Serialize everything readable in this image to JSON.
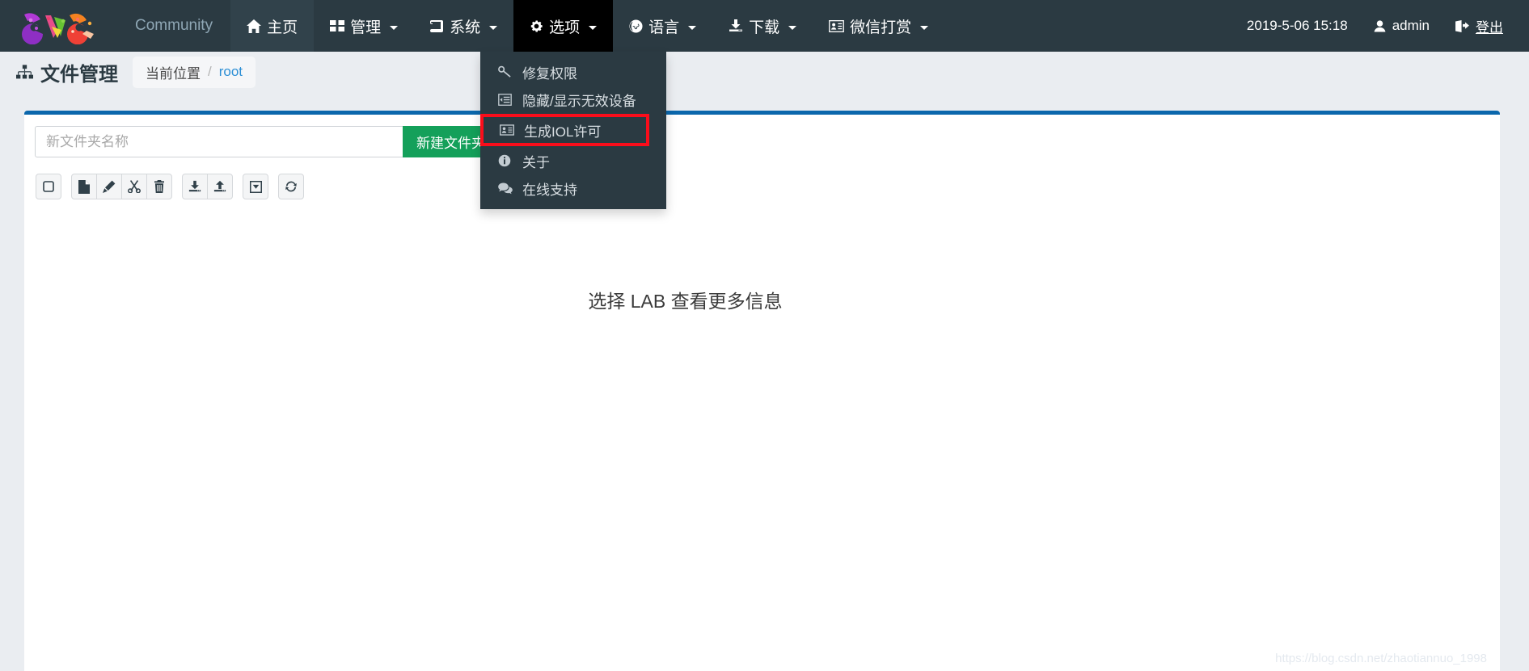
{
  "navbar": {
    "brand_alt": "eve-logo",
    "items": [
      {
        "label": "Community",
        "icon": "",
        "caret": false,
        "state": "muted"
      },
      {
        "label": "主页",
        "icon": "home-icon",
        "caret": false,
        "state": "active-soft"
      },
      {
        "label": "管理",
        "icon": "grid-icon",
        "caret": true,
        "state": "normal"
      },
      {
        "label": "系统",
        "icon": "book-icon",
        "caret": true,
        "state": "normal"
      },
      {
        "label": "选项",
        "icon": "gear-icon",
        "caret": true,
        "state": "open"
      },
      {
        "label": "语言",
        "icon": "globe-icon",
        "caret": true,
        "state": "normal"
      },
      {
        "label": "下载",
        "icon": "download-icon",
        "caret": true,
        "state": "normal"
      },
      {
        "label": "微信打赏",
        "icon": "contact-card-icon",
        "caret": true,
        "state": "normal"
      }
    ],
    "datetime": "2019-5-06  15:18",
    "user": "admin",
    "logout": "登出"
  },
  "dropdown": {
    "owner": "选项",
    "items": [
      {
        "label": "修复权限",
        "icon": "wrench-key-icon",
        "highlight": false
      },
      {
        "label": "隐藏/显示无效设备",
        "icon": "list-icon",
        "highlight": false
      },
      {
        "label": "生成IOL许可",
        "icon": "id-card-icon",
        "highlight": true
      },
      {
        "label": "关于",
        "icon": "info-icon",
        "highlight": false
      },
      {
        "label": "在线支持",
        "icon": "comment-icon",
        "highlight": false
      }
    ],
    "highlight_color": "#fb0d1b"
  },
  "subheader": {
    "title": "文件管理",
    "title_icon": "sitemap-icon",
    "breadcrumb_label": "当前位置",
    "breadcrumb_separator": "/",
    "breadcrumb_current": "root"
  },
  "panel": {
    "accent_color": "#0b67ac",
    "newfolder_placeholder": "新文件夹名称",
    "newfolder_value": "",
    "newfolder_button": "新建文件夹",
    "toolbar": [
      {
        "name": "select-all-checkbox",
        "icon": "square-icon"
      },
      {
        "name": "new-file-button",
        "icon": "file-icon"
      },
      {
        "name": "rename-button",
        "icon": "pencil-icon"
      },
      {
        "name": "cut-button",
        "icon": "scissors-icon"
      },
      {
        "name": "delete-button",
        "icon": "trash-icon"
      },
      {
        "name": "download-button",
        "icon": "download-icon"
      },
      {
        "name": "upload-button",
        "icon": "upload-icon"
      },
      {
        "name": "archive-button",
        "icon": "archive-icon"
      },
      {
        "name": "refresh-button",
        "icon": "refresh-icon"
      }
    ],
    "empty_hint": "选择 LAB 查看更多信息"
  },
  "watermark": "https://blog.csdn.net/zhaotiannuo_1998"
}
